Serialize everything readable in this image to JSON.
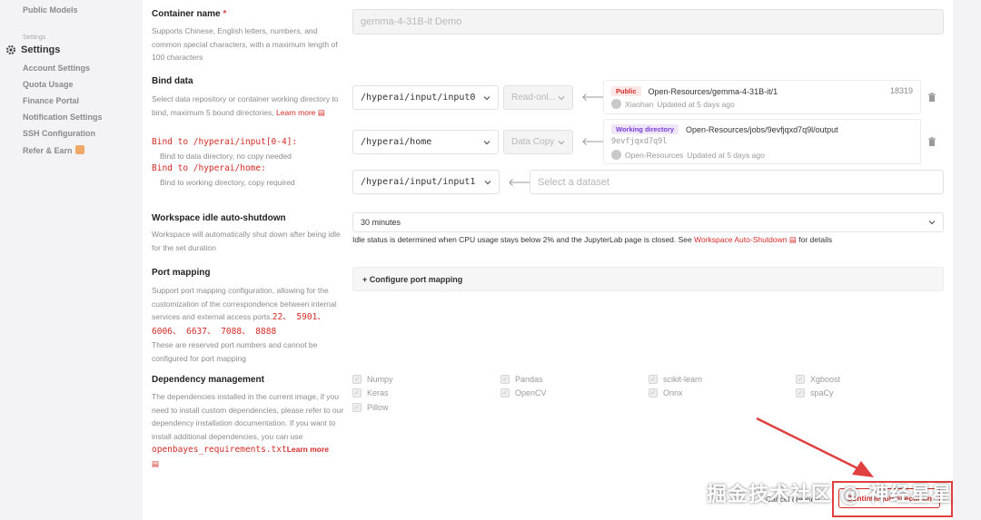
{
  "sidebar": {
    "public_models": "Public Models",
    "section": "Settings",
    "settings": "Settings",
    "items": [
      {
        "label": "Account Settings"
      },
      {
        "label": "Quota Usage"
      },
      {
        "label": "Finance Portal"
      },
      {
        "label": "Notification Settings"
      },
      {
        "label": "SSH Configuration"
      },
      {
        "label": "Refer & Earn"
      }
    ]
  },
  "container_name": {
    "label": "Container name",
    "required": "*",
    "desc": "Supports Chinese, English letters, numbers, and common special characters, with a maximum length of 100 characters",
    "value": "gemma-4-31B-it Demo"
  },
  "bind_data": {
    "label": "Bind data",
    "desc": "Select data repository or container working directory to bind, maximum 5 bound directories,",
    "learn_more": "Learn more",
    "hint1_code": "Bind to /hyperai/input[0-4]:",
    "hint1_text": "Bind to data directory, no copy needed",
    "hint2_code": "Bind to /hyperai/home:",
    "hint2_text": "Bind to working directory, copy required",
    "rows": [
      {
        "path": "/hyperai/input/input0",
        "mode": "Read-onl...",
        "badge": "Public",
        "source": "Open-Resources/gemma-4-31B-it/1",
        "size": "18319",
        "user": "Xiaohan",
        "updated": "Updated at 5 days ago"
      },
      {
        "path": "/hyperai/home",
        "mode": "Data Copy",
        "badge": "Working directory",
        "source": "Open-Resources/jobs/9evfjqxd7q9l/output",
        "id": "9evfjqxd7q9l",
        "user": "Open-Resources",
        "updated": "Updated at 5 days ago"
      },
      {
        "path": "/hyperai/input/input1",
        "placeholder": "Select a dataset"
      }
    ]
  },
  "idle": {
    "label": "Workspace idle auto-shutdown",
    "desc": "Workspace will automatically shut down after being idle for the set duration",
    "value": "30 minutes",
    "note_pre": "Idle status is determined when CPU usage stays below 2% and the JupyterLab page is closed. See",
    "note_link": "Workspace Auto-Shutdown",
    "note_post": "for details"
  },
  "port": {
    "label": "Port mapping",
    "desc": "Support port mapping configuration, allowing for the customization of the correspondence between internal services and external access ports.",
    "ports": "22、 5901、 6006、 6637、 7088、 8888",
    "desc2": "These are reserved port numbers and cannot be configured for port mapping",
    "button": "+ Configure port mapping"
  },
  "deps": {
    "label": "Dependency management",
    "desc": "The dependencies installed in the current image, if you need to install custom dependencies, please refer to our dependency installation documentation. If you want to install additional dependencies, you can use",
    "file": "openbayes_requirements.txt",
    "learn_more": "Learn more",
    "items": [
      "Numpy",
      "Pandas",
      "scikit-learn",
      "Xgboost",
      "Keras",
      "OpenCV",
      "Onnx",
      "spaCy",
      "Pillow"
    ]
  },
  "footer": {
    "cancel": "Cancel creation",
    "continue": "Continue job execution"
  },
  "watermark": "掘金技术社区 @ 神经星星",
  "colors": {
    "accent": "#d42b26",
    "annotation": "#e0403f"
  }
}
